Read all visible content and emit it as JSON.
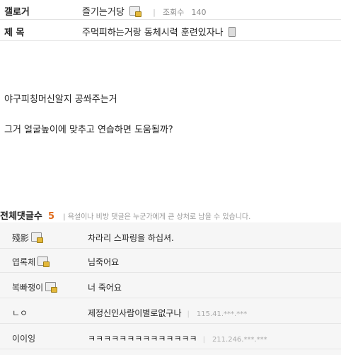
{
  "post": {
    "gallery_label": "갤로거",
    "author": "즐기는거당",
    "views_label": "조회수",
    "views_count": "140",
    "title_label": "제 목",
    "title": "주먹피하는거랑 동체시력 훈련있자나",
    "body": [
      "야구피칭머신알지 공쏴주는거",
      "그거 얼굴높이에 맞추고 연습하면 도움될까?"
    ]
  },
  "comments": {
    "label": "전체댓글수",
    "count": "5",
    "notice": "욕설이나 비방 댓글은 누군가에게 큰 상처로 남을 수 있습니다.",
    "items": [
      {
        "author": "殘影",
        "text": "차라리 스파링을 하십셔.",
        "ip": ""
      },
      {
        "author": "엽록체",
        "text": "님죽어요",
        "ip": ""
      },
      {
        "author": "복빠쟁이",
        "text": "너 죽어요",
        "ip": ""
      },
      {
        "author": "ㄴㅇ",
        "text": "제정신인사람이별로없구나",
        "ip": "115.41.***.***"
      },
      {
        "author": "이이잉",
        "text": "ㅋㅋㅋㅋㅋㅋㅋㅋㅋㅋㅋㅋㅋㅋ",
        "ip": "211.246.***.***"
      }
    ]
  },
  "icons": {
    "gallog": "gallog-badge-icon",
    "mobile": "mobile-icon"
  }
}
